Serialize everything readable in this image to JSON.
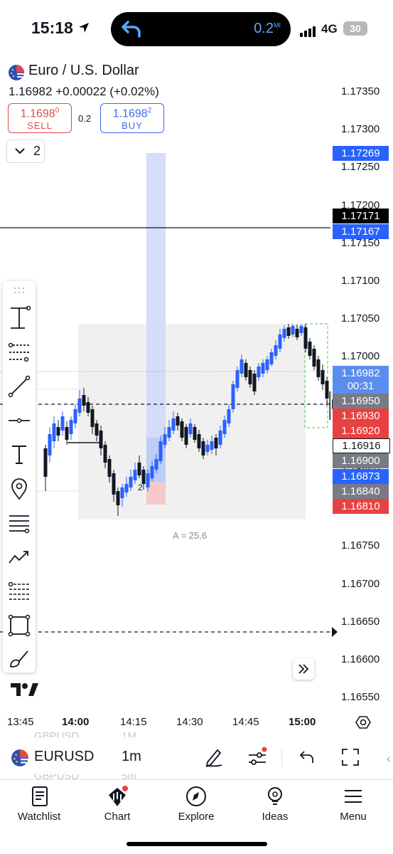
{
  "status_bar": {
    "time": "15:18",
    "distance": "0.2",
    "distance_unit": "MI",
    "network": "4G",
    "battery": "30"
  },
  "symbol": {
    "name": "Euro / U.S. Dollar",
    "last": "1.16982",
    "change": "+0.00022 (+0.02%)",
    "sell": {
      "price_main": "1.1698",
      "price_sup": "0",
      "label": "SELL"
    },
    "buy": {
      "price_main": "1.1698",
      "price_sup": "2",
      "label": "BUY"
    },
    "spread": "0.2",
    "indicator_count": "2"
  },
  "price_axis": {
    "ticks": [
      "1.17350",
      "1.17300",
      "1.17250",
      "1.17200",
      "1.17150",
      "1.17100",
      "1.17050",
      "1.17000",
      "1.16950",
      "1.16900",
      "1.16850",
      "1.16800",
      "1.16750",
      "1.16700",
      "1.16650",
      "1.16600",
      "1.16550"
    ],
    "badges": [
      {
        "label": "1.17269",
        "color": "#2962ff"
      },
      {
        "label": "1.17171",
        "color": "#000000"
      },
      {
        "label": "1.17167",
        "color": "#2962ff"
      },
      {
        "label": "1.16982",
        "color": "#5b8cf0"
      },
      {
        "label": "00:31",
        "color": "#5b8cf0"
      },
      {
        "label": "1.16950",
        "color": "#787b86"
      },
      {
        "label": "1.16930",
        "color": "#e84141"
      },
      {
        "label": "1.16920",
        "color": "#e84141"
      },
      {
        "label": "1.16916",
        "color": "#ffffff"
      },
      {
        "label": "1.16900",
        "color": "#787b86"
      },
      {
        "label": "1.16873",
        "color": "#2962ff"
      },
      {
        "label": "1.16840",
        "color": "#787b86"
      },
      {
        "label": "1.16810",
        "color": "#e84141"
      }
    ]
  },
  "time_axis": {
    "ticks": [
      "13:45",
      "14:00",
      "14:15",
      "14:30",
      "14:45",
      "15:00"
    ]
  },
  "chart_annotations": {
    "range_label": "A = 25.6",
    "position_label": "2"
  },
  "bottom_bar": {
    "symbol": "EURUSD",
    "interval": "1m",
    "ghost_above": [
      "GBPUSD",
      "1M"
    ],
    "ghost_below": [
      "GBPUSD",
      "5m"
    ]
  },
  "nav": [
    {
      "label": "Watchlist",
      "icon": "watchlist-icon"
    },
    {
      "label": "Chart",
      "icon": "chart-icon"
    },
    {
      "label": "Explore",
      "icon": "compass-icon"
    },
    {
      "label": "Ideas",
      "icon": "lightbulb-icon"
    },
    {
      "label": "Menu",
      "icon": "menu-icon"
    }
  ],
  "colors": {
    "up": "#2962ff",
    "down": "#131722",
    "sell": "#e04a4a",
    "buy": "#3f68e6"
  }
}
